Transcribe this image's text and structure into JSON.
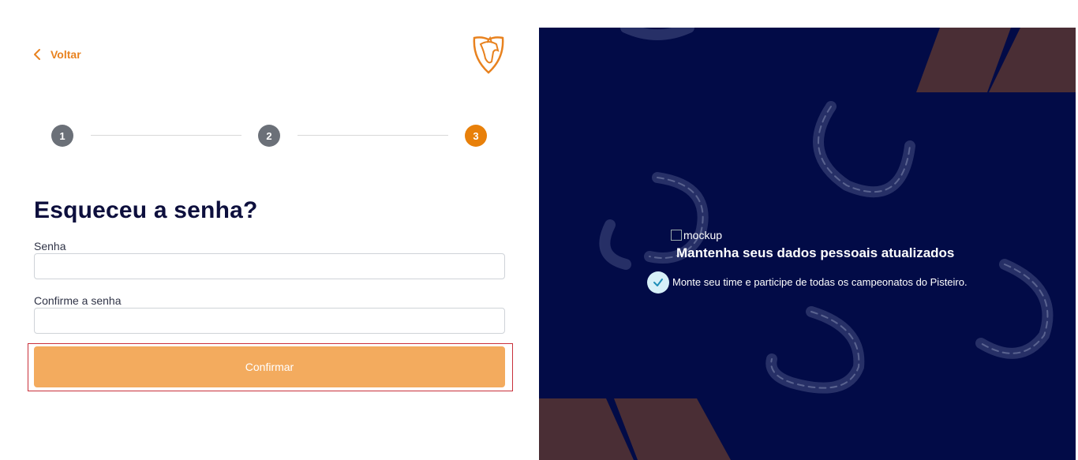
{
  "nav": {
    "back_label": "Voltar"
  },
  "brand": {
    "logo_icon": "horse-shield-logo-icon",
    "accent_color": "#e8800a"
  },
  "stepper": {
    "steps": [
      {
        "label": "1",
        "state": "completed"
      },
      {
        "label": "2",
        "state": "completed"
      },
      {
        "label": "3",
        "state": "active"
      }
    ]
  },
  "form": {
    "title": "Esqueceu a senha?",
    "password_label": "Senha",
    "password_value": "",
    "confirm_label": "Confirme a senha",
    "confirm_value": "",
    "submit_label": "Confirmar"
  },
  "promo": {
    "image_alt": "mockup",
    "headline": "Mantenha seus dados pessoais atualizados",
    "bullet_icon": "check-icon",
    "bullet_text": "Monte seu time e participe de todas os campeonatos do Pisteiro.",
    "background_color": "#020b47",
    "decoration_icon": "horseshoe-icon"
  }
}
